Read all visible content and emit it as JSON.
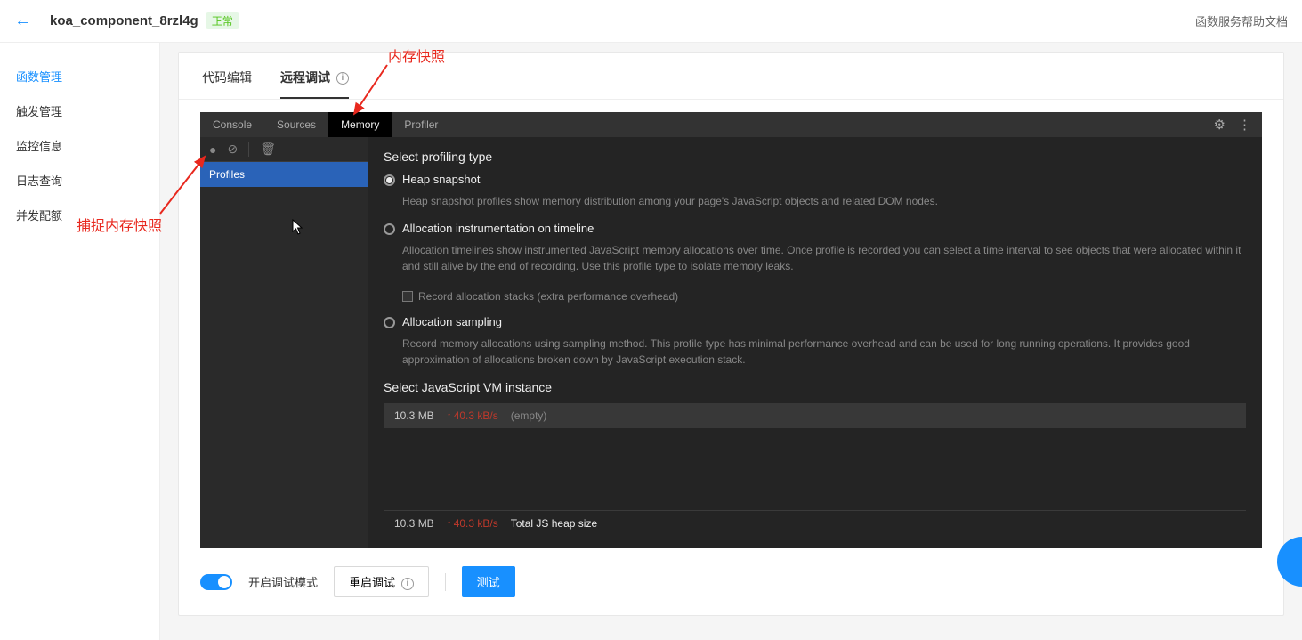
{
  "header": {
    "title": "koa_component_8rzl4g",
    "status": "正常",
    "help_link": "函数服务帮助文档"
  },
  "sidebar": {
    "items": [
      "函数管理",
      "触发管理",
      "监控信息",
      "日志查询",
      "并发配额"
    ]
  },
  "outer_tabs": {
    "code_edit": "代码编辑",
    "remote_debug": "远程调试"
  },
  "devtools": {
    "tabs": {
      "console": "Console",
      "sources": "Sources",
      "memory": "Memory",
      "profiler": "Profiler"
    },
    "profiles_header": "Profiles",
    "select_type_title": "Select profiling type",
    "options": {
      "heap": {
        "label": "Heap snapshot",
        "desc": "Heap snapshot profiles show memory distribution among your page's JavaScript objects and related DOM nodes."
      },
      "allocation_timeline": {
        "label": "Allocation instrumentation on timeline",
        "desc": "Allocation timelines show instrumented JavaScript memory allocations over time. Once profile is recorded you can select a time interval to see objects that were allocated within it and still alive by the end of recording. Use this profile type to isolate memory leaks.",
        "checkbox": "Record allocation stacks (extra performance overhead)"
      },
      "allocation_sampling": {
        "label": "Allocation sampling",
        "desc": "Record memory allocations using sampling method. This profile type has minimal performance overhead and can be used for long running operations. It provides good approximation of allocations broken down by JavaScript execution stack."
      }
    },
    "vm_title": "Select JavaScript VM instance",
    "vm_instance": {
      "size": "10.3 MB",
      "rate": "40.3 kB/s",
      "name": "(empty)"
    },
    "vm_footer": {
      "size": "10.3 MB",
      "rate": "40.3 kB/s",
      "label": "Total JS heap size"
    }
  },
  "bottom": {
    "toggle_label": "开启调试模式",
    "restart_btn": "重启调试",
    "test_btn": "测试"
  },
  "annotations": {
    "snapshot_label": "内存快照",
    "capture_label": "捕捉内存快照"
  }
}
